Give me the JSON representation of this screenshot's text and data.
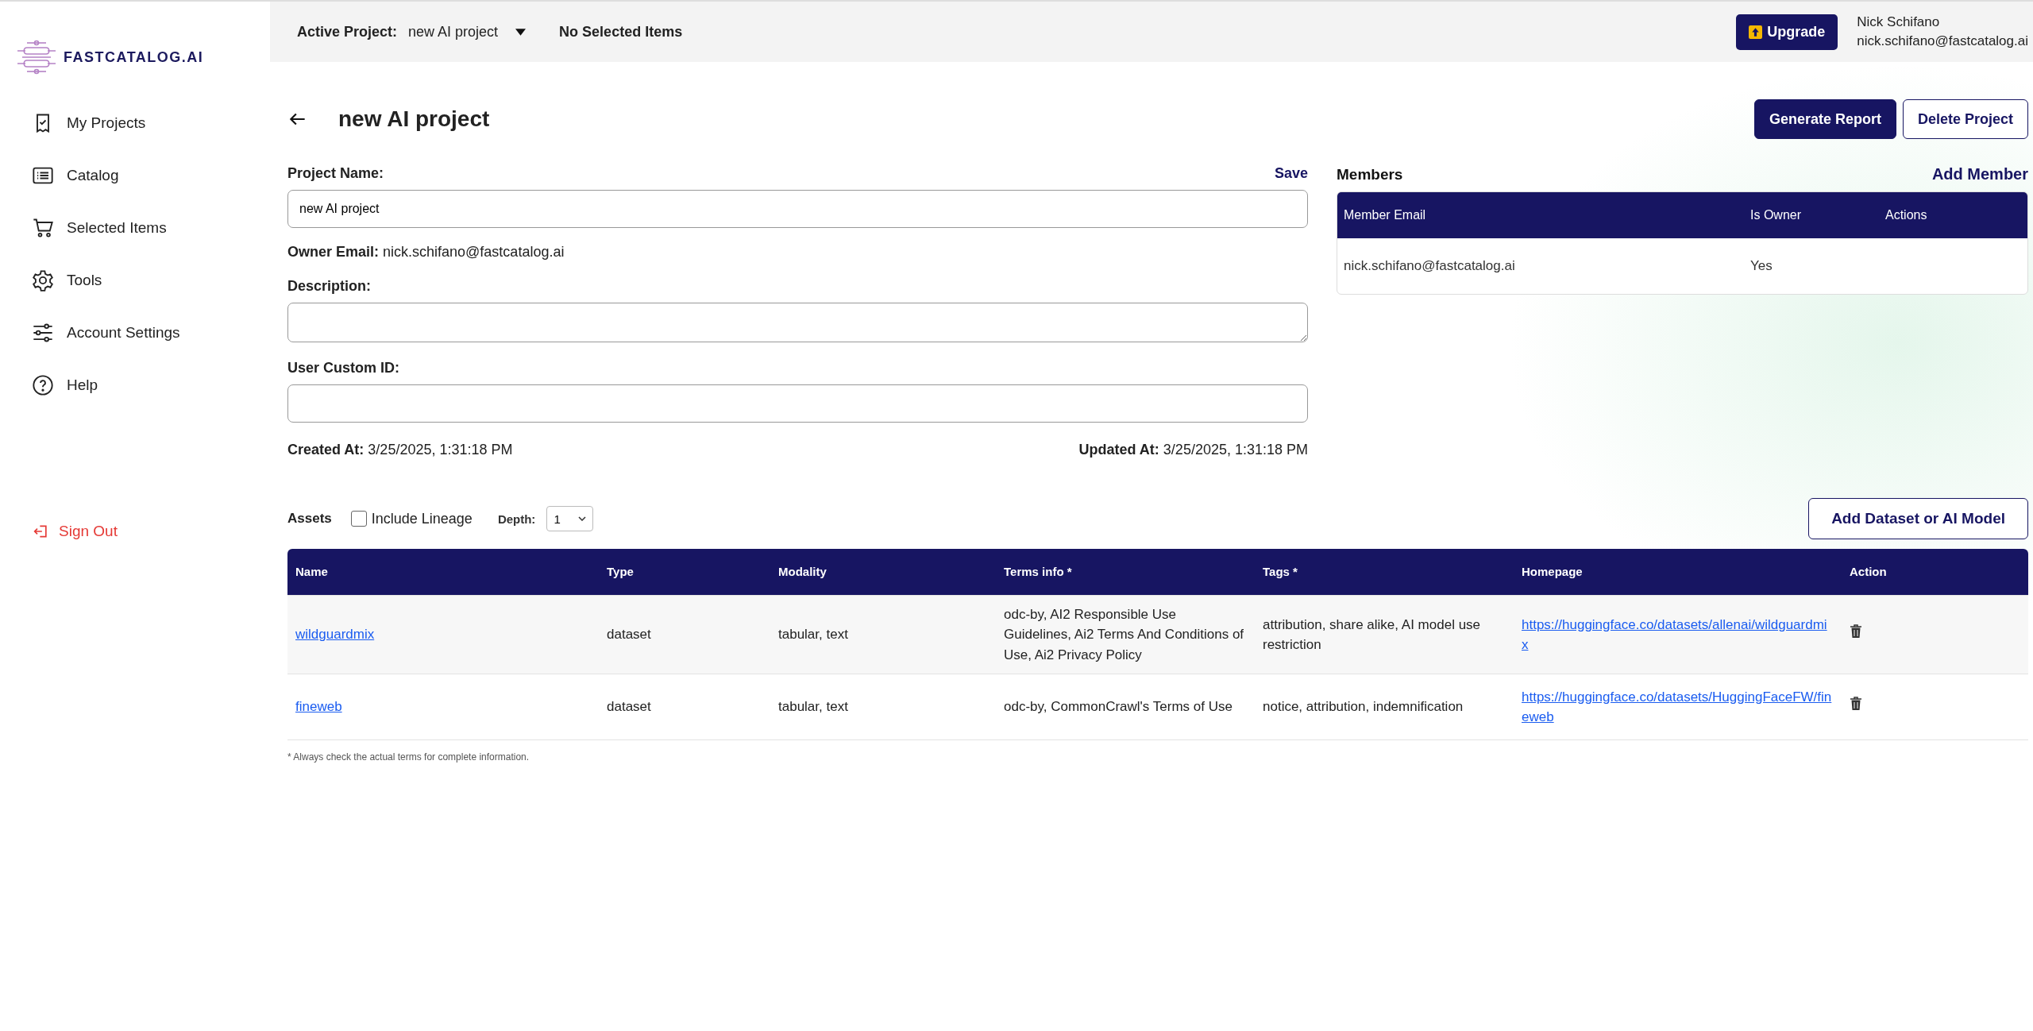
{
  "sidebar": {
    "logo": "FASTCATALOG.AI",
    "items": [
      {
        "label": "My Projects",
        "selected": false
      },
      {
        "label": "Catalog",
        "selected": false
      },
      {
        "label": "Selected Items",
        "selected": false
      },
      {
        "label": "Tools",
        "selected": false
      },
      {
        "label": "Account Settings",
        "selected": false
      },
      {
        "label": "Help",
        "selected": false
      }
    ],
    "sign_out": "Sign Out"
  },
  "top_bar": {
    "active_project_label": "Active Project:",
    "active_project": "new AI project",
    "selection": "No Selected Items",
    "upgrade": "Upgrade",
    "user_name": "Nick Schifano",
    "user_email": "nick.schifano@fastcatalog.ai"
  },
  "project": {
    "title": "new AI project",
    "generate_report": "Generate Report",
    "delete_project": "Delete Project",
    "name_label": "Project Name:",
    "save": "Save",
    "name_value": "new AI project",
    "owner_label": "Owner Email:",
    "owner_email": "nick.schifano@fastcatalog.ai",
    "description_label": "Description:",
    "custom_id_label": "User Custom ID:",
    "created_label": "Created At:",
    "created": "3/25/2025, 1:31:18 PM",
    "updated_label": "Updated At:",
    "updated": "3/25/2025, 1:31:18 PM"
  },
  "members": {
    "title": "Members",
    "add": "Add Member",
    "columns": [
      "Member Email",
      "Is Owner",
      "Actions"
    ],
    "rows": [
      {
        "email": "nick.schifano@fastcatalog.ai",
        "is_owner": "Yes"
      }
    ]
  },
  "assets": {
    "title": "Assets",
    "include_lineage": {
      "label": "Include Lineage",
      "checked": false
    },
    "depth_label": "Depth:",
    "depth": "1",
    "add": "Add Dataset or AI Model",
    "columns": [
      "Name",
      "Type",
      "Modality",
      "Terms info *",
      "Tags *",
      "Homepage",
      "Action"
    ],
    "rows": [
      {
        "name": "wildguardmix",
        "type": "dataset",
        "modality": "tabular, text",
        "terms": "odc-by, AI2 Responsible Use Guidelines, Ai2 Terms And Conditions of Use, Ai2 Privacy Policy",
        "tags": "attribution, share alike, AI model use restriction",
        "homepage": "https://huggingface.co/datasets/allenai/wildguardmix"
      },
      {
        "name": "fineweb",
        "type": "dataset",
        "modality": "tabular, text",
        "terms": "odc-by, CommonCrawl's Terms of Use",
        "tags": "notice, attribution, indemnification",
        "homepage": "https://huggingface.co/datasets/HuggingFaceFW/fineweb"
      }
    ],
    "footnote": "* Always check the actual terms for complete information."
  }
}
